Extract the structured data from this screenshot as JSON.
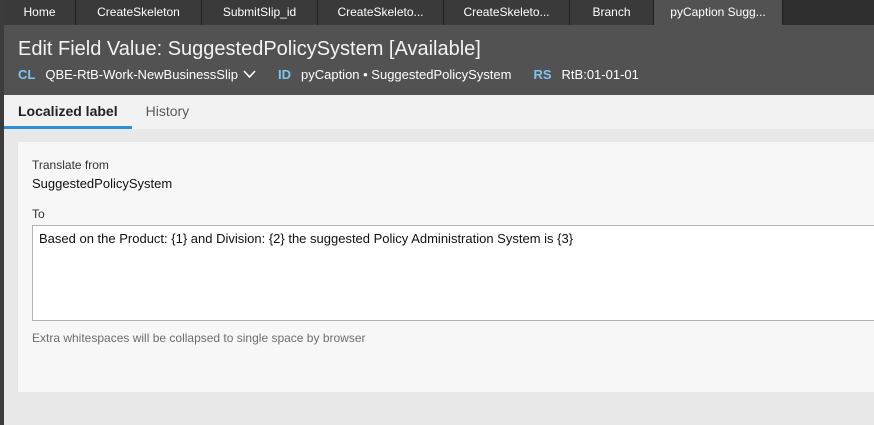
{
  "tabs": [
    {
      "label": "Home"
    },
    {
      "label": "CreateSkeleton"
    },
    {
      "label": "SubmitSlip_id"
    },
    {
      "label": "CreateSkeleto..."
    },
    {
      "label": "CreateSkeleto..."
    },
    {
      "label": "Branch"
    },
    {
      "label": "pyCaption Sugg..."
    }
  ],
  "header": {
    "title": "Edit Field Value: SuggestedPolicySystem [Available]",
    "cl_key": "CL",
    "cl_value": "QBE-RtB-Work-NewBusinessSlip",
    "id_key": "ID",
    "id_value": "pyCaption • SuggestedPolicySystem",
    "rs_key": "RS",
    "rs_value": "RtB:01-01-01"
  },
  "subtabs": [
    {
      "label": "Localized label",
      "active": true
    },
    {
      "label": "History",
      "active": false
    }
  ],
  "form": {
    "translate_from_label": "Translate from",
    "translate_from_value": "SuggestedPolicySystem",
    "to_label": "To",
    "to_value": "Based on the Product: {1} and Division: {2} the suggested Policy Administration System is {3}",
    "hint": "Extra whitespaces will be collapsed to single space by browser"
  },
  "icons": {
    "class_dropdown": "chevron-down-icon"
  },
  "colors": {
    "header_bg": "#525252",
    "tabbar_bg": "#2f2f2f",
    "meta_key": "#7ec4ef",
    "active_underline": "#2e8fd6"
  }
}
